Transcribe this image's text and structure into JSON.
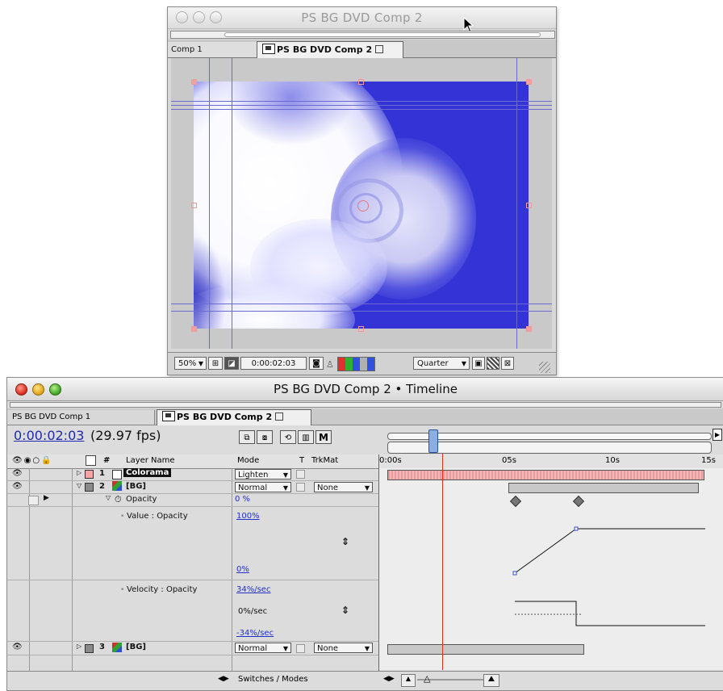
{
  "comp_window": {
    "title": "PS BG DVD Comp 2",
    "tabs": [
      {
        "label": "Comp 1"
      },
      {
        "label": "PS BG DVD Comp 2"
      }
    ],
    "footer": {
      "zoom": "50%",
      "timecode": "0:00:02:03",
      "resolution": "Quarter"
    }
  },
  "timeline_window": {
    "title": "PS BG DVD Comp 2 • Timeline",
    "tabs": [
      {
        "label": "PS BG DVD Comp 1"
      },
      {
        "label": "PS BG DVD Comp 2"
      }
    ],
    "timecode": "0:00:02:03",
    "fps": "(29.97 fps)",
    "columns": {
      "number": "#",
      "layer_name": "Layer Name",
      "mode": "Mode",
      "t": "T",
      "trkmat": "TrkMat"
    },
    "ruler": [
      "0:00s",
      "05s",
      "10s",
      "15s"
    ],
    "current_time_seconds": 2.1,
    "layers": [
      {
        "number": "1",
        "name": "Colorama",
        "mode": "Lighten",
        "label_color": "#f2a6a6"
      },
      {
        "number": "2",
        "name": "[BG]",
        "mode": "Normal",
        "trkmat": "None",
        "label_color": "#8a8a8a"
      },
      {
        "number": "3",
        "name": "[BG]",
        "mode": "Normal",
        "trkmat": "None",
        "label_color": "#8a8a8a"
      }
    ],
    "property": {
      "name": "Opacity",
      "value": "0 %",
      "value_graph_label": "Value : Opacity",
      "value_max": "100%",
      "value_min": "0%",
      "velocity_label": "Velocity : Opacity",
      "velocity_max": "34%/sec",
      "velocity_mid": "0%/sec",
      "velocity_min": "-34%/sec"
    },
    "keyframes_seconds": [
      5.0,
      7.5
    ],
    "footer": {
      "switches_label": "Switches / Modes"
    }
  },
  "colors": {
    "image_blue": "#3434d6",
    "current_time_indicator": "#e03020",
    "value_link": "#2230c8"
  },
  "icons": [
    "eye-icon",
    "speaker-icon",
    "solo-icon",
    "lock-icon",
    "stopwatch-icon",
    "footage-icon",
    "twirl-arrow-icon",
    "graph-toggle-icon"
  ]
}
